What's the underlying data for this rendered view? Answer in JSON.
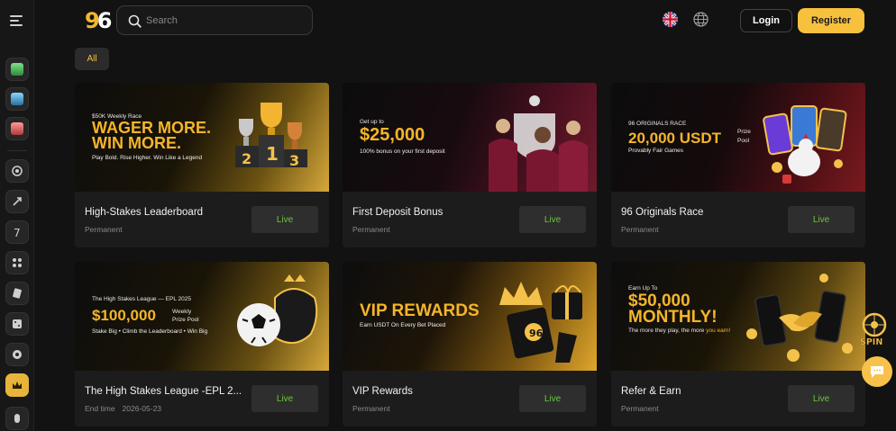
{
  "logo": {
    "part1": "9",
    "part2": "6"
  },
  "search": {
    "placeholder": "Search"
  },
  "header": {
    "login_label": "Login",
    "register_label": "Register"
  },
  "filters": {
    "all_label": "All"
  },
  "cards": [
    {
      "title": "High-Stakes Leaderboard",
      "subtitle": "Permanent",
      "button": "Live",
      "banner": {
        "line1": "$50K Weekly Race",
        "line2": "WAGER MORE.",
        "line3": "WIN MORE.",
        "line4": "Play Bold. Rise Higher. Win Like a Legend"
      }
    },
    {
      "title": "First Deposit Bonus",
      "subtitle": "Permanent",
      "button": "Live",
      "banner": {
        "line1": "Get up to",
        "line2": "$25,000",
        "line3": "100% bonus on your first deposit"
      }
    },
    {
      "title": "96 Originals Race",
      "subtitle": "Permanent",
      "button": "Live",
      "banner": {
        "line1": "96 ORIGINALS RACE",
        "line2": "20,000 USDT",
        "line2b": "Prize",
        "line2c": "Pool",
        "line3": "Provably Fair Games"
      }
    },
    {
      "title": "The High Stakes League -EPL 2...",
      "subtitle_label": "End time",
      "subtitle_value": "2026-05-23",
      "button": "Live",
      "banner": {
        "line1": "The High Stakes League — EPL 2025",
        "line2": "$100,000",
        "line2b": "Weekly",
        "line2c": "Prize Pool",
        "line3": "Stake Big • Climb the Leaderboard • Win Big"
      }
    },
    {
      "title": "VIP Rewards",
      "subtitle": "Permanent",
      "button": "Live",
      "banner": {
        "line1": "VIP REWARDS",
        "line2": "Earn USDT On Every Bet Placed"
      }
    },
    {
      "title": "Refer & Earn",
      "subtitle": "Permanent",
      "button": "Live",
      "banner": {
        "line1": "Earn Up To",
        "line2": "$50,000",
        "line3": "MONTHLY!",
        "line4a": "The more they play, the more ",
        "line4b": "you earn!"
      }
    }
  ],
  "widgets": {
    "spin_label": "SPIN"
  },
  "colors": {
    "accent": "#f7c13d",
    "live_green": "#6cc53d",
    "background": "#121212",
    "card": "#1c1c1c"
  }
}
